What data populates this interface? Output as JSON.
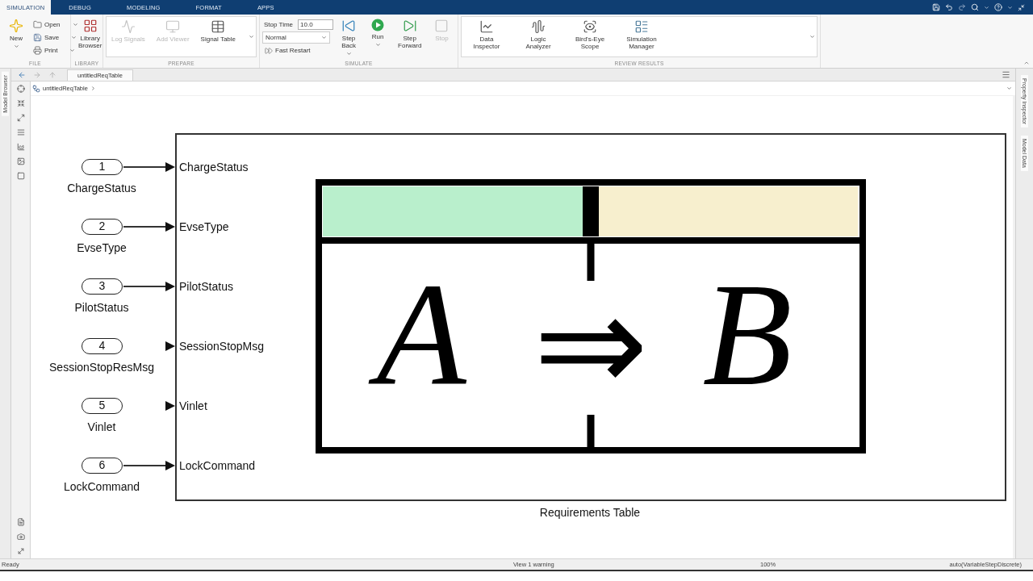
{
  "ribbon_tabs": [
    {
      "label": "SIMULATION",
      "selected": true
    },
    {
      "label": "DEBUG",
      "selected": false
    },
    {
      "label": "MODELING",
      "selected": false
    },
    {
      "label": "FORMAT",
      "selected": false
    },
    {
      "label": "APPS",
      "selected": false
    }
  ],
  "ribbon_sections": [
    {
      "title": "FILE",
      "gallery": false,
      "items": [
        {
          "kind": "large",
          "label": "New",
          "disabled": false,
          "menu": true
        },
        {
          "kind": "small",
          "label": "Open",
          "disabled": false,
          "menu": true
        },
        {
          "kind": "small",
          "label": "Save",
          "disabled": false,
          "menu": true
        },
        {
          "kind": "small",
          "label": "Print",
          "disabled": false,
          "menu": true
        }
      ]
    },
    {
      "title": "LIBRARY",
      "gallery": false,
      "items": [
        {
          "kind": "large",
          "label": "Library Browser",
          "disabled": false,
          "menu": false
        }
      ]
    },
    {
      "title": "PREPARE",
      "gallery": true,
      "items": [
        {
          "kind": "large",
          "label": "Log Signals",
          "disabled": true,
          "menu": false
        },
        {
          "kind": "large",
          "label": "Add Viewer",
          "disabled": true,
          "menu": false
        },
        {
          "kind": "large",
          "label": "Signal Table",
          "disabled": false,
          "menu": false
        }
      ]
    },
    {
      "title": "SIMULATE",
      "gallery": false,
      "items": [
        {
          "kind": "field",
          "label": "Stop Time",
          "value": "10.0"
        },
        {
          "kind": "dropdown",
          "value": "Normal"
        },
        {
          "kind": "toggle",
          "label": "Fast Restart",
          "on": false
        },
        {
          "kind": "large",
          "label": "Step Back",
          "disabled": false,
          "menu": true
        },
        {
          "kind": "large",
          "label": "Run",
          "disabled": false,
          "menu": true
        },
        {
          "kind": "large",
          "label": "Step Forward",
          "disabled": false,
          "menu": false
        },
        {
          "kind": "large",
          "label": "Stop",
          "disabled": true,
          "menu": false
        }
      ]
    },
    {
      "title": "REVIEW RESULTS",
      "gallery": true,
      "items": [
        {
          "kind": "large",
          "label": "Data Inspector",
          "disabled": false,
          "menu": false
        },
        {
          "kind": "large",
          "label": "Logic Analyzer",
          "disabled": false,
          "menu": false
        },
        {
          "kind": "large",
          "label": "Bird's-Eye Scope",
          "disabled": false,
          "menu": false
        },
        {
          "kind": "large",
          "label": "Simulation Manager",
          "disabled": false,
          "menu": false
        }
      ]
    }
  ],
  "left_panel_tabs": [
    {
      "label": "Model Browser"
    }
  ],
  "right_panel_tabs": [
    {
      "label": "Property Inspector"
    },
    {
      "label": "Model Data"
    }
  ],
  "editor": {
    "tab": {
      "label": "untitledReqTable"
    },
    "breadcrumb": "untitledReqTable"
  },
  "diagram": {
    "inports": [
      {
        "number": "1",
        "name": "ChargeStatus",
        "connected": true
      },
      {
        "number": "2",
        "name": "EvseType",
        "connected": true
      },
      {
        "number": "3",
        "name": "PilotStatus",
        "connected": true
      },
      {
        "number": "4",
        "name": "SessionStopResMsg",
        "connected": false
      },
      {
        "number": "5",
        "name": "Vinlet",
        "connected": false
      },
      {
        "number": "6",
        "name": "LockCommand",
        "connected": true
      }
    ],
    "block": {
      "name": "Requirements Table",
      "ports": [
        "ChargeStatus",
        "EvseType",
        "PilotStatus",
        "SessionStopMsg",
        "Vinlet",
        "LockCommand"
      ],
      "header_cells": [
        {
          "color": "#b9efcc"
        },
        {
          "color": "#f7efce"
        }
      ],
      "formula": [
        "A",
        "⇒",
        "B"
      ]
    }
  },
  "status_bar": {
    "status": "Ready",
    "warning": "View 1 warning",
    "zoom": "100%",
    "solver": "auto(VariableStepDiscrete)"
  }
}
